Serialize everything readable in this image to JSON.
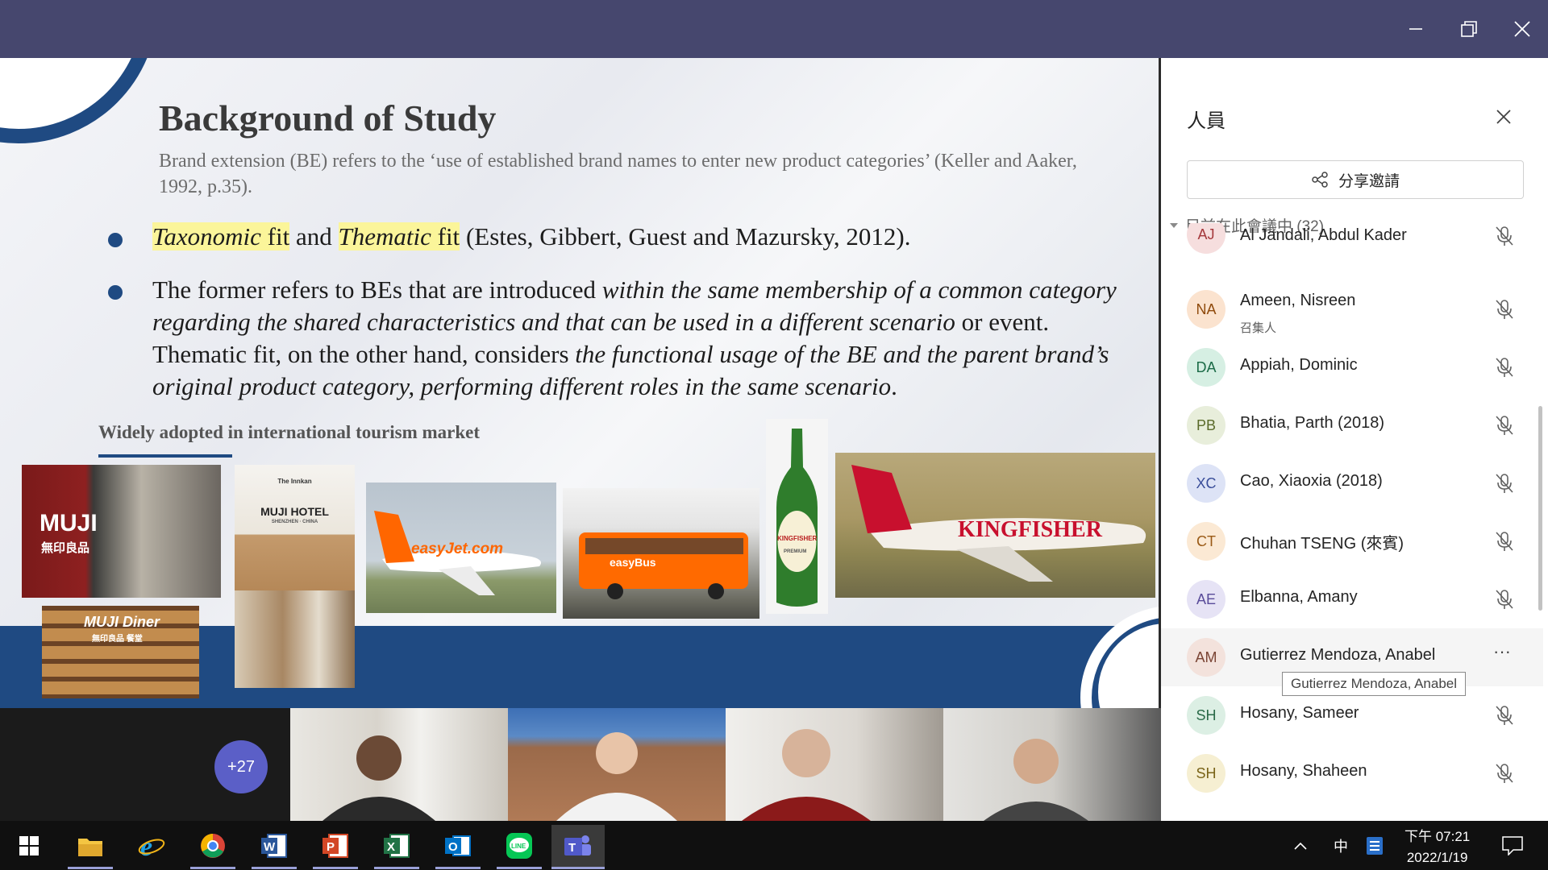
{
  "window": {
    "controls": [
      "minimize",
      "restore",
      "close"
    ]
  },
  "slide": {
    "title": "Background of Study",
    "definition": "Brand extension (BE) refers to the ‘use of established brand names to enter new product categories’ (Keller and Aaker, 1992, p.35).",
    "bullet1": {
      "term1": "Taxonomic",
      "fit1": " fit",
      "and": " and ",
      "term2": "Thematic",
      "fit2": " fit",
      "rest": " (Estes, Gibbert, Guest and Mazursky, 2012)."
    },
    "bullet2": {
      "p1": "The former refers to BEs that are introduced ",
      "p2": "within the same membership of a common category regarding the shared characteristics and that can be used in a different scenario",
      "p3": " or event. Thematic fit, on the other hand, considers ",
      "p4": "the functional usage of the BE and the parent brand’s original product category, performing different roles in the same scenario",
      "p5": "."
    },
    "subheading": "Widely adopted in international tourism market",
    "images": {
      "muji_store": "MUJI",
      "muji_store_cn": "無印良品",
      "muji_hotel_top": "The Innkan",
      "muji_hotel": "MUJI HOTEL",
      "muji_hotel_city": "SHENZHEN · CHINA",
      "muji_diner": "MUJI Diner",
      "muji_diner_cn": "無印良品 餐堂",
      "easyjet": "easyJet.com",
      "easybus": "easyBus",
      "kingfisher_beer": "KINGFISHER",
      "kingfisher_beer_premium": "PREMIUM",
      "kingfisher_plane": "KINGFISHER"
    }
  },
  "panel": {
    "title": "人員",
    "share_label": "分享邀請",
    "section_label": "目前在此會議中 (32)",
    "people": [
      {
        "initials": "AJ",
        "name": "Al Jandali, Abdul Kader",
        "role": "",
        "bg": "#f6dede",
        "fg": "#a4373a"
      },
      {
        "initials": "NA",
        "name": "Ameen, Nisreen",
        "role": "召集人",
        "bg": "#fbe3cf",
        "fg": "#8f4a0b"
      },
      {
        "initials": "DA",
        "name": "Appiah, Dominic",
        "role": "",
        "bg": "#d6efe3",
        "fg": "#1b6b47"
      },
      {
        "initials": "PB",
        "name": "Bhatia, Parth (2018)",
        "role": "",
        "bg": "#e8eedb",
        "fg": "#5a6b2a"
      },
      {
        "initials": "XC",
        "name": "Cao, Xiaoxia (2018)",
        "role": "",
        "bg": "#dde3f6",
        "fg": "#3a4e9a"
      },
      {
        "initials": "CT",
        "name": "Chuhan TSENG (來賓)",
        "role": "",
        "bg": "#fbe9d4",
        "fg": "#9a5a16"
      },
      {
        "initials": "AE",
        "name": "Elbanna, Amany",
        "role": "",
        "bg": "#e6e3f5",
        "fg": "#5a4c9a"
      },
      {
        "initials": "AM",
        "name": "Gutierrez Mendoza, Anabel",
        "role": "",
        "bg": "#f3e2dc",
        "fg": "#7a4434"
      },
      {
        "initials": "SH",
        "name": "Hosany, Sameer",
        "role": "",
        "bg": "#dcefe4",
        "fg": "#2a6a48"
      },
      {
        "initials": "SH",
        "name": "Hosany, Shaheen",
        "role": "",
        "bg": "#f6efd2",
        "fg": "#7a6418"
      }
    ],
    "tooltip": "Gutierrez Mendoza, Anabel",
    "more_label": "···"
  },
  "video_strip": {
    "overflow_count": "+27"
  },
  "taskbar": {
    "apps": [
      "windows-start",
      "file-explorer",
      "internet-explorer",
      "chrome",
      "word",
      "powerpoint",
      "excel",
      "outlook",
      "line",
      "teams"
    ],
    "ime": "中",
    "time": "下午 07:21",
    "date": "2022/1/19"
  }
}
